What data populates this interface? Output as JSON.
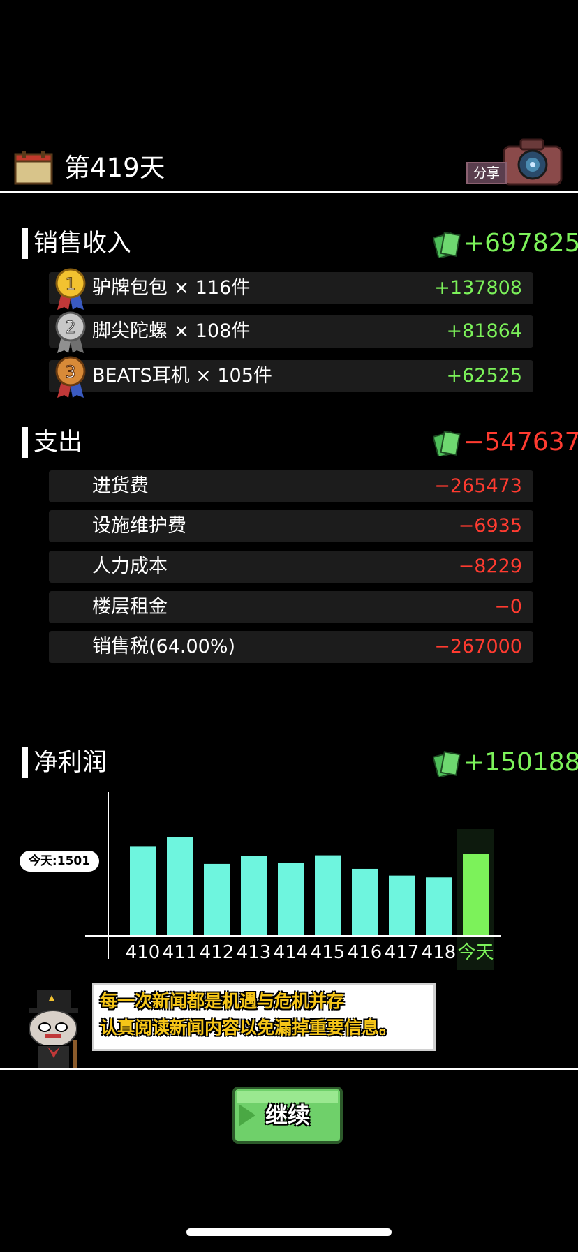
{
  "header": {
    "day_title": "第419天",
    "share_label": "分享"
  },
  "sales": {
    "title": "销售收入",
    "total": "+697825",
    "items": [
      {
        "rank": "1",
        "label": "驴牌包包 × 116件",
        "value": "+137808"
      },
      {
        "rank": "2",
        "label": "脚尖陀螺 × 108件",
        "value": "+81864"
      },
      {
        "rank": "3",
        "label": "BEATS耳机 × 105件",
        "value": "+62525"
      }
    ]
  },
  "expenses": {
    "title": "支出",
    "total": "−547637",
    "items": [
      {
        "label": "进货费",
        "value": "−265473"
      },
      {
        "label": "设施维护费",
        "value": "−6935"
      },
      {
        "label": "人力成本",
        "value": "−8229"
      },
      {
        "label": "楼层租金",
        "value": "−0"
      },
      {
        "label": "销售税(64.00%)",
        "value": "−267000"
      }
    ]
  },
  "net_profit": {
    "title": "净利润",
    "total": "+150188"
  },
  "chart_data": {
    "type": "bar",
    "categories": [
      "410",
      "411",
      "412",
      "413",
      "414",
      "415",
      "416",
      "417",
      "418",
      "今天"
    ],
    "values": [
      1450,
      1600,
      1160,
      1290,
      1180,
      1300,
      1080,
      970,
      940,
      1320
    ],
    "highlight": "今天",
    "marker_label": "今天:1501",
    "ylim": [
      0,
      2500
    ],
    "colors": {
      "bar": "#6ef5de",
      "today": "#7cf25a",
      "today_bg": "#0d1a0d"
    }
  },
  "tip": {
    "lines": [
      "每一次新闻都是机遇与危机并存",
      "认真阅读新闻内容以免漏掉重要信息。"
    ]
  },
  "continue_label": "继续",
  "colors": {
    "positive": "#7cf25a",
    "negative": "#ff3b30",
    "row_bg": "#1c1c1c"
  },
  "icons": {
    "calendar": "calendar-icon",
    "camera": "camera-icon",
    "money": "money-icon",
    "mascot": "cat-mascot-icon"
  }
}
